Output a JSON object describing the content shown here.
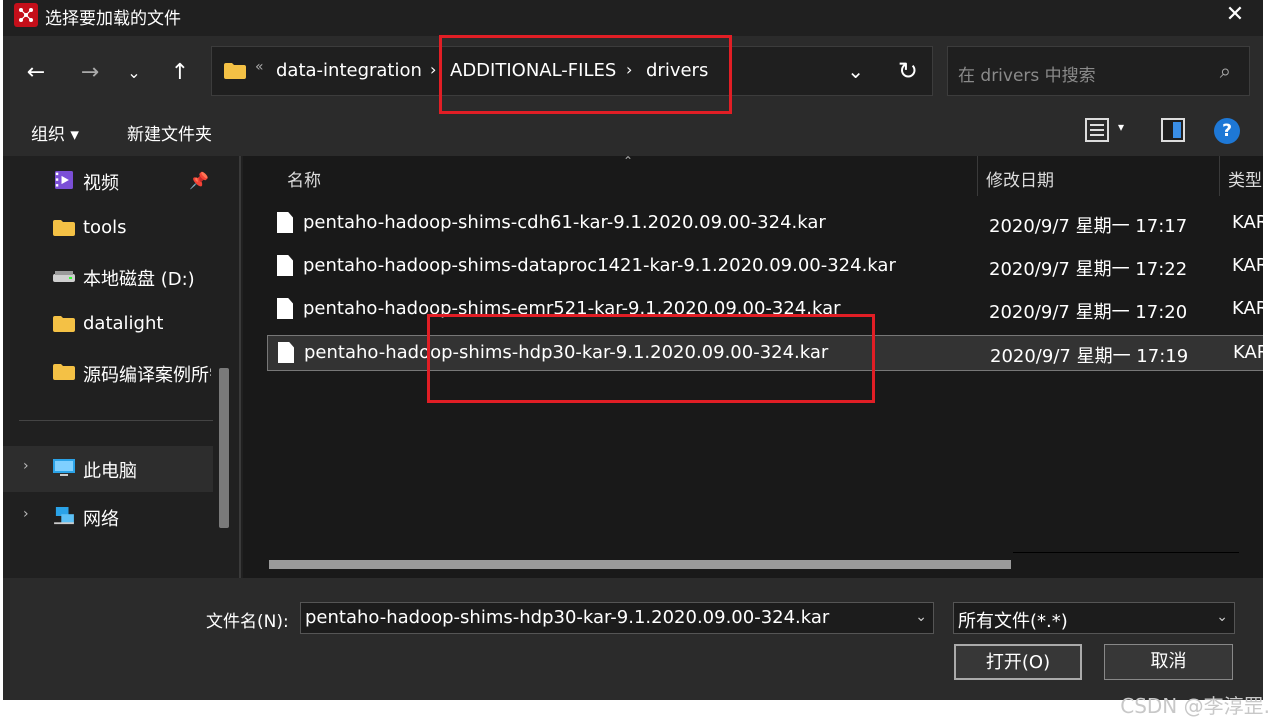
{
  "window": {
    "title": "选择要加载的文件"
  },
  "nav": {
    "address": {
      "ellipsis": "«",
      "crumbs": [
        "data-integration",
        "ADDITIONAL-FILES",
        "drivers"
      ],
      "separator": "›"
    },
    "search_placeholder": "在 drivers 中搜索"
  },
  "commandbar": {
    "organize": "组织 ▾",
    "new_folder": "新建文件夹",
    "help": "?"
  },
  "sidebar": {
    "items": [
      {
        "label": "视频",
        "icon": "video-icon"
      },
      {
        "label": "tools",
        "icon": "folder-icon"
      },
      {
        "label": "本地磁盘 (D:)",
        "icon": "drive-icon"
      },
      {
        "label": "datalight",
        "icon": "folder-icon"
      },
      {
        "label": "源码编译案例所需",
        "icon": "folder-icon"
      },
      {
        "label": "此电脑",
        "icon": "computer-icon"
      },
      {
        "label": "网络",
        "icon": "network-icon"
      }
    ]
  },
  "columns": {
    "name": "名称",
    "modified": "修改日期",
    "type": "类型"
  },
  "files": [
    {
      "name": "pentaho-hadoop-shims-cdh61-kar-9.1.2020.09.00-324.kar",
      "date": "2020/9/7 星期一 17:17",
      "type": "KAR"
    },
    {
      "name": "pentaho-hadoop-shims-dataproc1421-kar-9.1.2020.09.00-324.kar",
      "date": "2020/9/7 星期一 17:22",
      "type": "KAR"
    },
    {
      "name": "pentaho-hadoop-shims-emr521-kar-9.1.2020.09.00-324.kar",
      "date": "2020/9/7 星期一 17:20",
      "type": "KAR"
    },
    {
      "name": "pentaho-hadoop-shims-hdp30-kar-9.1.2020.09.00-324.kar",
      "date": "2020/9/7 星期一 17:19",
      "type": "KAR",
      "selected": true
    }
  ],
  "footer": {
    "filename_label": "文件名(N):",
    "filename_value": "pentaho-hadoop-shims-hdp30-kar-9.1.2020.09.00-324.kar",
    "filetype_value": "所有文件(*.*)",
    "open_label": "打开(O)",
    "cancel_label": "取消"
  },
  "watermark": "CSDN @李淳罡.",
  "colors": {
    "accent": "#1e78d6",
    "annotation_red": "#e11e25",
    "app_icon": "#c40f1a"
  }
}
